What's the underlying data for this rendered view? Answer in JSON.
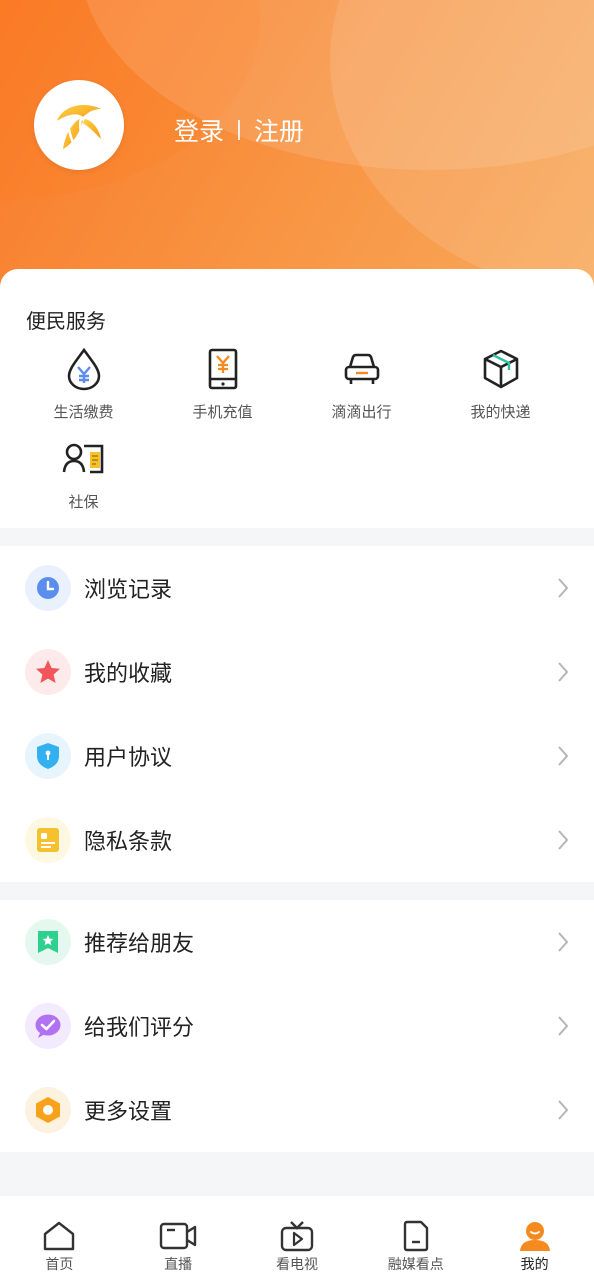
{
  "header": {
    "login_label": "登录",
    "register_label": "注册"
  },
  "services": {
    "title": "便民服务",
    "items": [
      {
        "label": "生活缴费",
        "icon": "water-drop-yuan-icon"
      },
      {
        "label": "手机充值",
        "icon": "phone-yuan-icon"
      },
      {
        "label": "滴滴出行",
        "icon": "car-icon"
      },
      {
        "label": "我的快递",
        "icon": "package-icon"
      },
      {
        "label": "社保",
        "icon": "id-card-icon"
      }
    ]
  },
  "menu1": [
    {
      "label": "浏览记录",
      "icon": "clock-icon",
      "color": "#5b8def"
    },
    {
      "label": "我的收藏",
      "icon": "star-icon",
      "color": "#f0565a"
    },
    {
      "label": "用户协议",
      "icon": "shield-icon",
      "color": "#32b0f0"
    },
    {
      "label": "隐私条款",
      "icon": "document-icon",
      "color": "#f5c12e"
    }
  ],
  "menu2": [
    {
      "label": "推荐给朋友",
      "icon": "bookmark-star-icon",
      "color": "#2fcf8e"
    },
    {
      "label": "给我们评分",
      "icon": "chat-check-icon",
      "color": "#b072f2"
    },
    {
      "label": "更多设置",
      "icon": "hexagon-gear-icon",
      "color": "#f7a21b"
    }
  ],
  "tabs": [
    {
      "label": "首页",
      "icon": "home-icon"
    },
    {
      "label": "直播",
      "icon": "video-camera-icon"
    },
    {
      "label": "看电视",
      "icon": "tv-icon"
    },
    {
      "label": "融媒看点",
      "icon": "document-icon"
    },
    {
      "label": "我的",
      "icon": "user-icon"
    }
  ],
  "colors": {
    "brand": "#f97a2a",
    "active_tab": "#f58a1f"
  }
}
